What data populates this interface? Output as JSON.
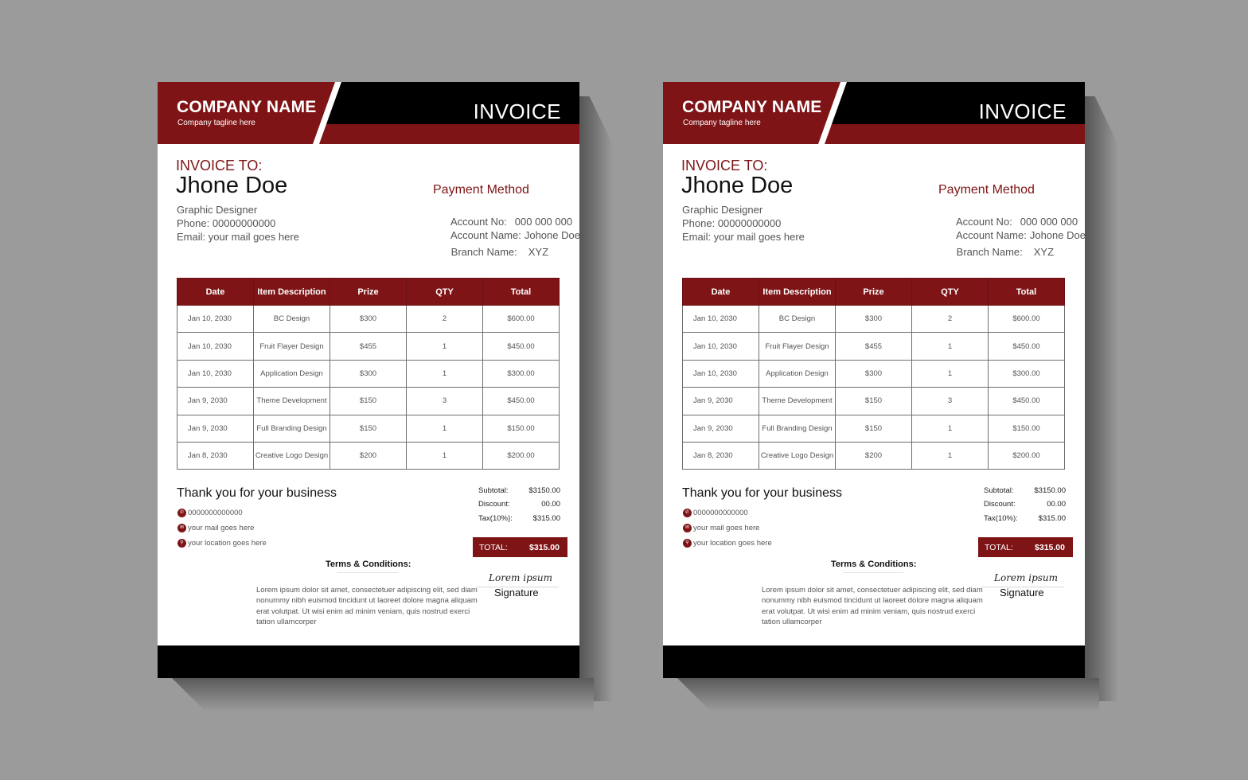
{
  "colors": {
    "brand_red": "#7e1416",
    "black": "#000000",
    "background": "#9b9b9b"
  },
  "documents": [
    {
      "header": {
        "company_name": "COMPANY NAME",
        "tagline": "Company tagline here",
        "title": "INVOICE"
      },
      "bill_to": {
        "label": "INVOICE TO:",
        "name": "Jhone Doe",
        "role": "Graphic Designer",
        "phone": "Phone: 00000000000",
        "email": "Email: your mail goes here"
      },
      "payment": {
        "title": "Payment Method",
        "account_no_label": "Account No:",
        "account_no": "000 000 000",
        "account_name_label": "Account Name:",
        "account_name": "Johone Doe",
        "branch_label": "Branch Name:",
        "branch": "XYZ"
      },
      "table": {
        "headers": [
          "Date",
          "Item Description",
          "Prize",
          "QTY",
          "Total"
        ],
        "rows": [
          [
            "Jan 10, 2030",
            "BC Design",
            "$300",
            "2",
            "$600.00"
          ],
          [
            "Jan 10, 2030",
            "Fruit Flayer Design",
            "$455",
            "1",
            "$450.00"
          ],
          [
            "Jan 10, 2030",
            "Application Design",
            "$300",
            "1",
            "$300.00"
          ],
          [
            "Jan 9, 2030",
            "Theme Development",
            "$150",
            "3",
            "$450.00"
          ],
          [
            "Jan 9, 2030",
            "Full Branding Design",
            "$150",
            "1",
            "$150.00"
          ],
          [
            "Jan 8, 2030",
            "Creative Logo Design",
            "$200",
            "1",
            "$200.00"
          ]
        ]
      },
      "footer": {
        "thanks": "Thank you for your business",
        "contacts": [
          {
            "icon": "phone-icon",
            "glyph": "✆",
            "text": "0000000000000"
          },
          {
            "icon": "mail-icon",
            "glyph": "✉",
            "text": "your mail goes here"
          },
          {
            "icon": "location-icon",
            "glyph": "⚲",
            "text": "your location goes here"
          }
        ]
      },
      "summary": {
        "subtotal_label": "Subtotal:",
        "subtotal": "$3150.00",
        "discount_label": "Discount:",
        "discount": "00.00",
        "tax_label": "Tax(10%):",
        "tax": "$315.00",
        "total_label": "TOTAL:",
        "total": "$315.00"
      },
      "terms": {
        "title": "Terms & Conditions:",
        "body": "Lorem ipsum dolor sit amet, consectetuer adipiscing elit, sed diam nonummy nibh euismod tincidunt ut laoreet dolore magna aliquam erat volutpat. Ut wisi enim ad minim veniam, quis nostrud exerci tation ullamcorper"
      },
      "signature": {
        "script": "Lorem ipsum",
        "label": "Signature"
      }
    },
    {
      "header": {
        "company_name": "COMPANY NAME",
        "tagline": "Company tagline here",
        "title": "INVOICE"
      },
      "bill_to": {
        "label": "INVOICE TO:",
        "name": "Jhone Doe",
        "role": "Graphic Designer",
        "phone": "Phone: 00000000000",
        "email": "Email: your mail goes here"
      },
      "payment": {
        "title": "Payment Method",
        "account_no_label": "Account No:",
        "account_no": "000 000 000",
        "account_name_label": "Account Name:",
        "account_name": "Johone Doe",
        "branch_label": "Branch Name:",
        "branch": "XYZ"
      },
      "table": {
        "headers": [
          "Date",
          "Item Description",
          "Prize",
          "QTY",
          "Total"
        ],
        "rows": [
          [
            "Jan 10, 2030",
            "BC Design",
            "$300",
            "2",
            "$600.00"
          ],
          [
            "Jan 10, 2030",
            "Fruit Flayer Design",
            "$455",
            "1",
            "$450.00"
          ],
          [
            "Jan 10, 2030",
            "Application Design",
            "$300",
            "1",
            "$300.00"
          ],
          [
            "Jan 9, 2030",
            "Theme Development",
            "$150",
            "3",
            "$450.00"
          ],
          [
            "Jan 9, 2030",
            "Full Branding Design",
            "$150",
            "1",
            "$150.00"
          ],
          [
            "Jan 8, 2030",
            "Creative Logo Design",
            "$200",
            "1",
            "$200.00"
          ]
        ]
      },
      "footer": {
        "thanks": "Thank you for your business",
        "contacts": [
          {
            "icon": "phone-icon",
            "glyph": "✆",
            "text": "0000000000000"
          },
          {
            "icon": "mail-icon",
            "glyph": "✉",
            "text": "your mail goes here"
          },
          {
            "icon": "location-icon",
            "glyph": "⚲",
            "text": "your location goes here"
          }
        ]
      },
      "summary": {
        "subtotal_label": "Subtotal:",
        "subtotal": "$3150.00",
        "discount_label": "Discount:",
        "discount": "00.00",
        "tax_label": "Tax(10%):",
        "tax": "$315.00",
        "total_label": "TOTAL:",
        "total": "$315.00"
      },
      "terms": {
        "title": "Terms & Conditions:",
        "body": "Lorem ipsum dolor sit amet, consectetuer adipiscing elit, sed diam nonummy nibh euismod tincidunt ut laoreet dolore magna aliquam erat volutpat. Ut wisi enim ad minim veniam, quis nostrud exerci tation ullamcorper"
      },
      "signature": {
        "script": "Lorem ipsum",
        "label": "Signature"
      }
    }
  ]
}
